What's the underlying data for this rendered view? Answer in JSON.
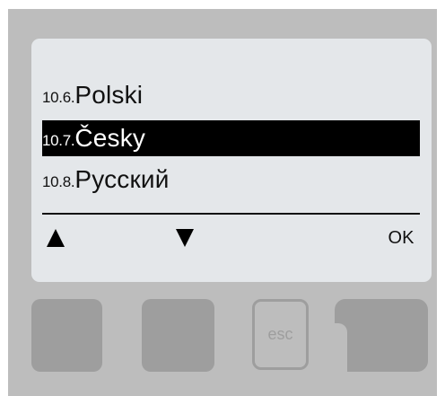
{
  "menu": {
    "items": [
      {
        "number": "10.6.",
        "label": "Polski",
        "selected": false
      },
      {
        "number": "10.7.",
        "label": "Česky",
        "selected": true
      },
      {
        "number": "10.8.",
        "label": "Русский",
        "selected": false
      }
    ]
  },
  "softkeys": {
    "up_icon": "triangle-up-icon",
    "down_icon": "triangle-down-icon",
    "ok_label": "OK"
  },
  "hardware_buttons": {
    "esc_label": "esc"
  },
  "colors": {
    "device_body": "#bdbdbd",
    "lcd_background": "#e4e7ea",
    "selection_background": "#000000",
    "button_gray": "#9e9e9e"
  }
}
